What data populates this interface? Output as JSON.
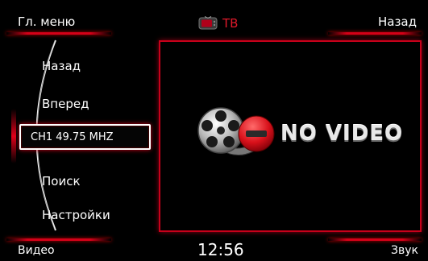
{
  "header": {
    "main_menu_label": "Гл. меню",
    "back_label": "Назад",
    "source_label": "ТВ",
    "source_icon": "tv-icon"
  },
  "menu": {
    "items": [
      {
        "label": "Назад"
      },
      {
        "label": "Вперед"
      },
      {
        "label": "CH1 49.75 MHZ"
      },
      {
        "label": "Поиск"
      },
      {
        "label": "Настройки"
      }
    ]
  },
  "video": {
    "status_text": "NO VIDEO",
    "status_icon": "film-reel-no-entry-icon"
  },
  "footer": {
    "video_label": "Видео",
    "time": "12:56",
    "sound_label": "Звук"
  },
  "colors": {
    "accent": "#d40018",
    "background": "#000000",
    "text": "#ffffff"
  }
}
